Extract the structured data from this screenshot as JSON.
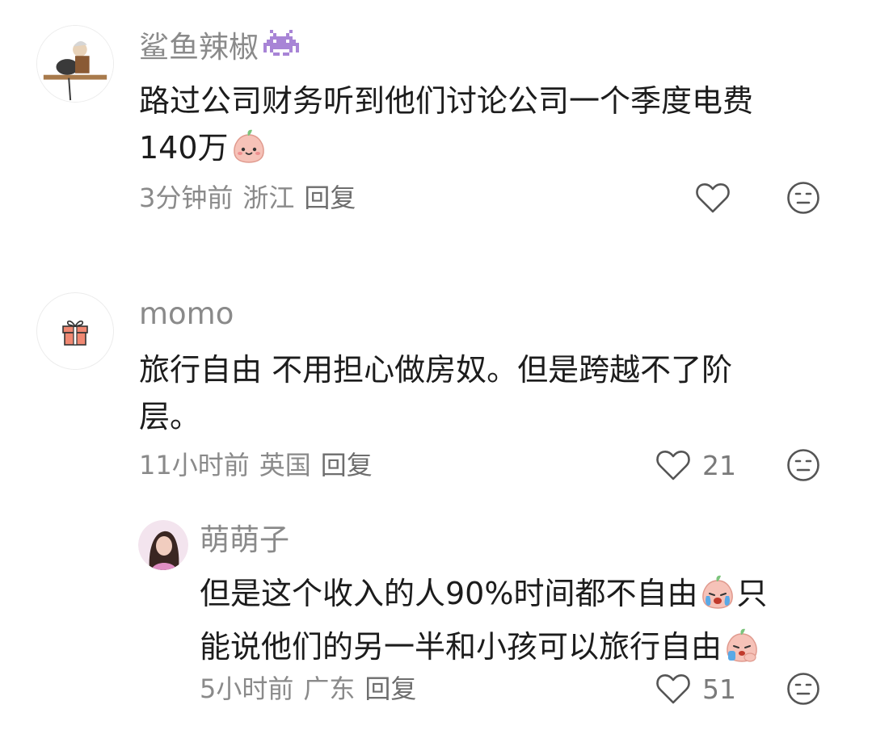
{
  "comments": [
    {
      "username": "鲨鱼辣椒",
      "username_badge": "space-invader-icon",
      "text_lines": [
        "路过公司财务听到他们讨论公司一个季度电费",
        "140万"
      ],
      "time": "3分钟前",
      "location": "浙江",
      "reply_label": "回复",
      "likes": ""
    },
    {
      "username": "momo",
      "text_lines": [
        "旅行自由 不用担心做房奴。但是跨越不了阶",
        "层。"
      ],
      "time": "11小时前",
      "location": "英国",
      "reply_label": "回复",
      "likes": "21"
    },
    {
      "username": "萌萌子",
      "text_lines": [
        "但是这个收入的人90%时间都不自由",
        "只",
        "能说他们的另一半和小孩可以旅行自由"
      ],
      "time": "5小时前",
      "location": "广东",
      "reply_label": "回复",
      "likes": "51"
    }
  ],
  "colors": {
    "meta_gray": "#8a8a8a",
    "text": "#1c1c1c",
    "badge_purple": "#a884d6",
    "emoji_pink": "#f4b6ad"
  }
}
